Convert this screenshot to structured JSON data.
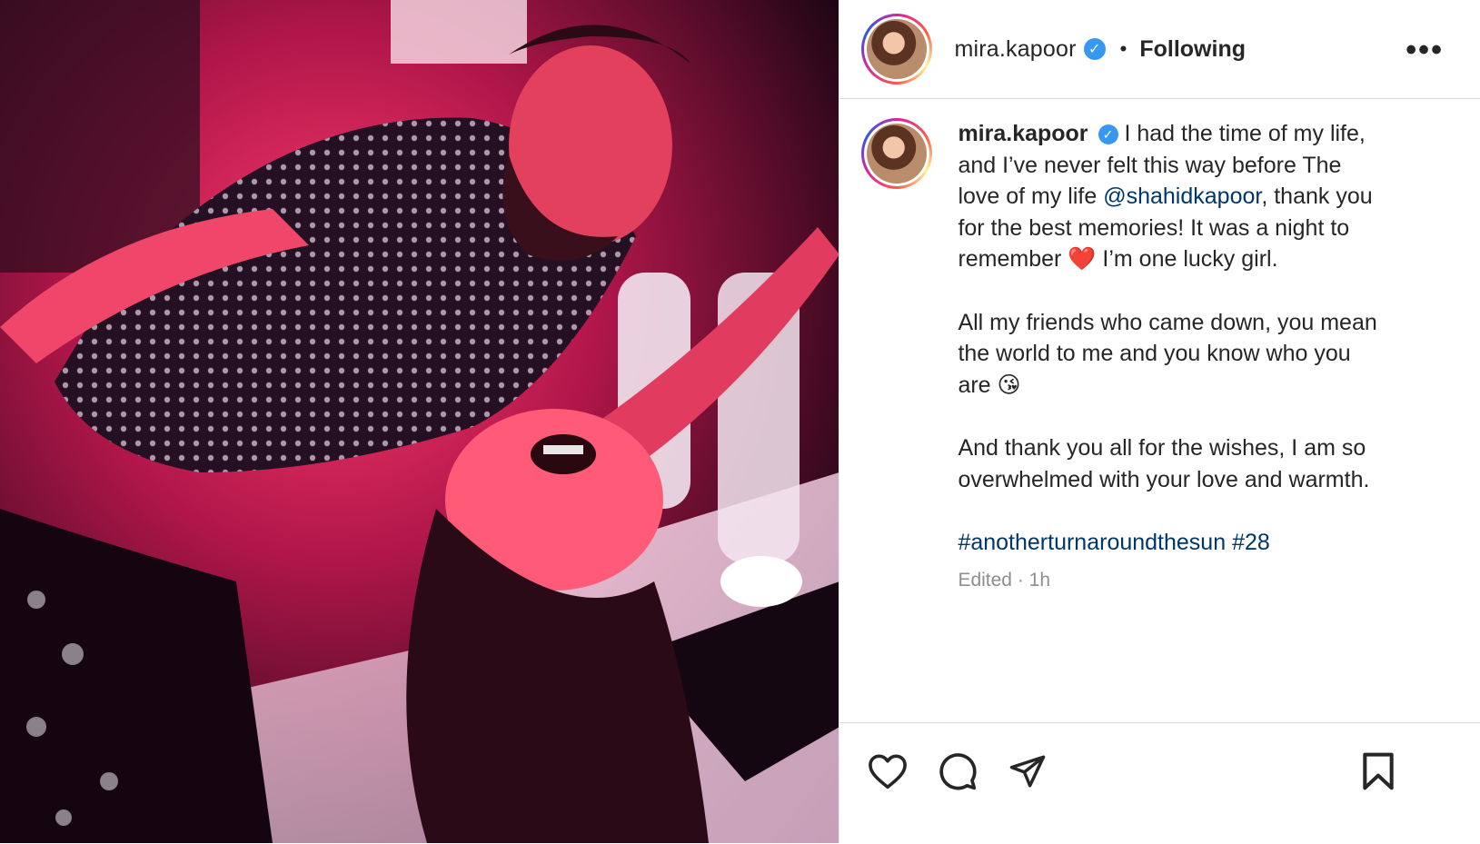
{
  "post": {
    "username": "mira.kapoor",
    "verified_icon": "verified-badge-icon",
    "separator": "•",
    "follow_status": "Following",
    "more_label": "•••",
    "caption": {
      "line1": "I had the time of my life, and I’ve never felt this way before The love of my life ",
      "mention": "@shahidkapoor",
      "line1b": ", thank you for the best memories! It was a night to remember ",
      "heart": "❤️",
      "line1c": " I’m one lucky girl.",
      "para2": "All my friends who came down, you mean the world to me and you know who you are ",
      "kiss": "😘",
      "para3": "And thank you all for the wishes, I am so overwhelmed with your love and warmth.",
      "hashtag1": "#anotherturnaroundthesun",
      "hashtag2": "#28"
    },
    "meta": "Edited · 1h",
    "actions": {
      "like_icon": "heart-icon",
      "comment_icon": "comment-icon",
      "share_icon": "send-icon",
      "save_icon": "bookmark-icon"
    },
    "colors": {
      "link": "#00376b",
      "verified": "#3897f0",
      "muted": "#8e8e8e"
    }
  }
}
